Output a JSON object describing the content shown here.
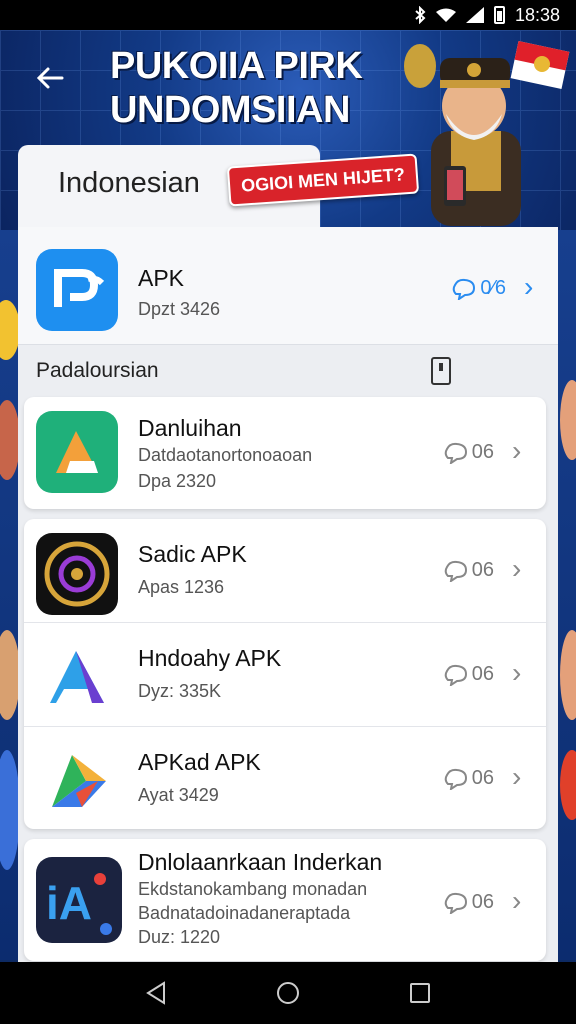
{
  "status": {
    "time": "18:38"
  },
  "hero": {
    "title_line1": "PUKOIIA PIRK",
    "title_line2": "UNDOMSIIAN"
  },
  "header": {
    "language": "Indonesian",
    "promo": "OGIOI MEN HIJET?"
  },
  "featured": {
    "name": "APK",
    "meta": "Dpzt 3426",
    "count": "0⁄6"
  },
  "section": {
    "title": "Padaloursian"
  },
  "apps": [
    {
      "name": "Danluihan",
      "desc": "Datdaotanortonoaoan",
      "meta": "Dpa 2320",
      "count": "06",
      "icon": "orange-a-icon"
    },
    {
      "name": "Sadic APK",
      "desc": "",
      "meta": "Apas 1236",
      "count": "06",
      "icon": "gold-emblem-icon"
    },
    {
      "name": "Hndoahy APK",
      "desc": "",
      "meta": "Dyz: 335K",
      "count": "06",
      "icon": "blue-a-icon"
    },
    {
      "name": "APKad APK",
      "desc": "",
      "meta": "Ayat 3429",
      "count": "06",
      "icon": "play-arrow-icon"
    },
    {
      "name": "Dnlolaanrkaan Inderkan",
      "desc": "Ekdstanokambang monadan",
      "desc2": "Badnatadoinadaneraptada",
      "meta": "Duz: 1220",
      "count": "06",
      "icon": "ia-logo-icon"
    }
  ],
  "colors": {
    "accent": "#2a8cf0",
    "promo_red": "#d9232a",
    "hero_blue": "#123a86"
  }
}
